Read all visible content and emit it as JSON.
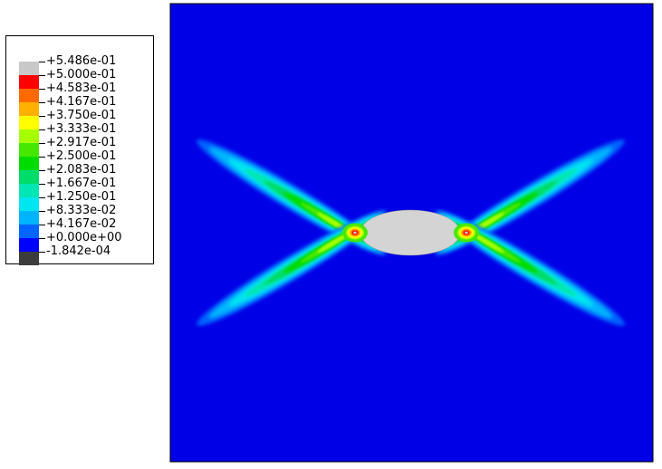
{
  "legend": {
    "colors": [
      "#c8c8c8",
      "#ff0000",
      "#ff6a00",
      "#ffb000",
      "#ffff00",
      "#a6ff00",
      "#46e800",
      "#00dc00",
      "#00dc6a",
      "#00e6b4",
      "#00e6f0",
      "#00b4ff",
      "#0064ff",
      "#0000ff",
      "#3c3c3c"
    ],
    "labels": [
      "+5.486e-01",
      "+5.000e-01",
      "+4.583e-01",
      "+4.167e-01",
      "+3.750e-01",
      "+3.333e-01",
      "+2.917e-01",
      "+2.500e-01",
      "+2.083e-01",
      "+1.667e-01",
      "+1.250e-01",
      "+8.333e-02",
      "+4.167e-02",
      "+0.000e+00",
      "-1.842e-04"
    ]
  },
  "contour": {
    "background_color": "#0000e6",
    "hole_color": "#d4d4d4"
  }
}
